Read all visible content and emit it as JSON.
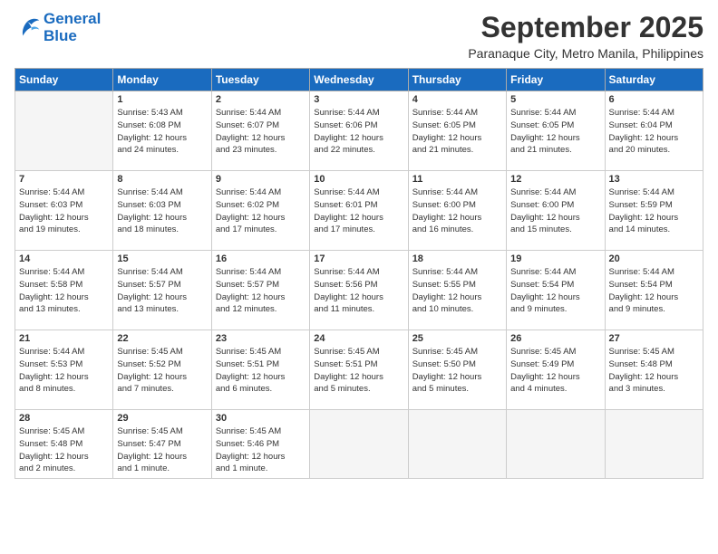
{
  "logo": {
    "line1": "General",
    "line2": "Blue"
  },
  "title": "September 2025",
  "subtitle": "Paranaque City, Metro Manila, Philippines",
  "headers": [
    "Sunday",
    "Monday",
    "Tuesday",
    "Wednesday",
    "Thursday",
    "Friday",
    "Saturday"
  ],
  "weeks": [
    [
      {
        "day": "",
        "info": ""
      },
      {
        "day": "1",
        "info": "Sunrise: 5:43 AM\nSunset: 6:08 PM\nDaylight: 12 hours\nand 24 minutes."
      },
      {
        "day": "2",
        "info": "Sunrise: 5:44 AM\nSunset: 6:07 PM\nDaylight: 12 hours\nand 23 minutes."
      },
      {
        "day": "3",
        "info": "Sunrise: 5:44 AM\nSunset: 6:06 PM\nDaylight: 12 hours\nand 22 minutes."
      },
      {
        "day": "4",
        "info": "Sunrise: 5:44 AM\nSunset: 6:05 PM\nDaylight: 12 hours\nand 21 minutes."
      },
      {
        "day": "5",
        "info": "Sunrise: 5:44 AM\nSunset: 6:05 PM\nDaylight: 12 hours\nand 21 minutes."
      },
      {
        "day": "6",
        "info": "Sunrise: 5:44 AM\nSunset: 6:04 PM\nDaylight: 12 hours\nand 20 minutes."
      }
    ],
    [
      {
        "day": "7",
        "info": "Sunrise: 5:44 AM\nSunset: 6:03 PM\nDaylight: 12 hours\nand 19 minutes."
      },
      {
        "day": "8",
        "info": "Sunrise: 5:44 AM\nSunset: 6:03 PM\nDaylight: 12 hours\nand 18 minutes."
      },
      {
        "day": "9",
        "info": "Sunrise: 5:44 AM\nSunset: 6:02 PM\nDaylight: 12 hours\nand 17 minutes."
      },
      {
        "day": "10",
        "info": "Sunrise: 5:44 AM\nSunset: 6:01 PM\nDaylight: 12 hours\nand 17 minutes."
      },
      {
        "day": "11",
        "info": "Sunrise: 5:44 AM\nSunset: 6:00 PM\nDaylight: 12 hours\nand 16 minutes."
      },
      {
        "day": "12",
        "info": "Sunrise: 5:44 AM\nSunset: 6:00 PM\nDaylight: 12 hours\nand 15 minutes."
      },
      {
        "day": "13",
        "info": "Sunrise: 5:44 AM\nSunset: 5:59 PM\nDaylight: 12 hours\nand 14 minutes."
      }
    ],
    [
      {
        "day": "14",
        "info": "Sunrise: 5:44 AM\nSunset: 5:58 PM\nDaylight: 12 hours\nand 13 minutes."
      },
      {
        "day": "15",
        "info": "Sunrise: 5:44 AM\nSunset: 5:57 PM\nDaylight: 12 hours\nand 13 minutes."
      },
      {
        "day": "16",
        "info": "Sunrise: 5:44 AM\nSunset: 5:57 PM\nDaylight: 12 hours\nand 12 minutes."
      },
      {
        "day": "17",
        "info": "Sunrise: 5:44 AM\nSunset: 5:56 PM\nDaylight: 12 hours\nand 11 minutes."
      },
      {
        "day": "18",
        "info": "Sunrise: 5:44 AM\nSunset: 5:55 PM\nDaylight: 12 hours\nand 10 minutes."
      },
      {
        "day": "19",
        "info": "Sunrise: 5:44 AM\nSunset: 5:54 PM\nDaylight: 12 hours\nand 9 minutes."
      },
      {
        "day": "20",
        "info": "Sunrise: 5:44 AM\nSunset: 5:54 PM\nDaylight: 12 hours\nand 9 minutes."
      }
    ],
    [
      {
        "day": "21",
        "info": "Sunrise: 5:44 AM\nSunset: 5:53 PM\nDaylight: 12 hours\nand 8 minutes."
      },
      {
        "day": "22",
        "info": "Sunrise: 5:45 AM\nSunset: 5:52 PM\nDaylight: 12 hours\nand 7 minutes."
      },
      {
        "day": "23",
        "info": "Sunrise: 5:45 AM\nSunset: 5:51 PM\nDaylight: 12 hours\nand 6 minutes."
      },
      {
        "day": "24",
        "info": "Sunrise: 5:45 AM\nSunset: 5:51 PM\nDaylight: 12 hours\nand 5 minutes."
      },
      {
        "day": "25",
        "info": "Sunrise: 5:45 AM\nSunset: 5:50 PM\nDaylight: 12 hours\nand 5 minutes."
      },
      {
        "day": "26",
        "info": "Sunrise: 5:45 AM\nSunset: 5:49 PM\nDaylight: 12 hours\nand 4 minutes."
      },
      {
        "day": "27",
        "info": "Sunrise: 5:45 AM\nSunset: 5:48 PM\nDaylight: 12 hours\nand 3 minutes."
      }
    ],
    [
      {
        "day": "28",
        "info": "Sunrise: 5:45 AM\nSunset: 5:48 PM\nDaylight: 12 hours\nand 2 minutes."
      },
      {
        "day": "29",
        "info": "Sunrise: 5:45 AM\nSunset: 5:47 PM\nDaylight: 12 hours\nand 1 minute."
      },
      {
        "day": "30",
        "info": "Sunrise: 5:45 AM\nSunset: 5:46 PM\nDaylight: 12 hours\nand 1 minute."
      },
      {
        "day": "",
        "info": ""
      },
      {
        "day": "",
        "info": ""
      },
      {
        "day": "",
        "info": ""
      },
      {
        "day": "",
        "info": ""
      }
    ]
  ]
}
